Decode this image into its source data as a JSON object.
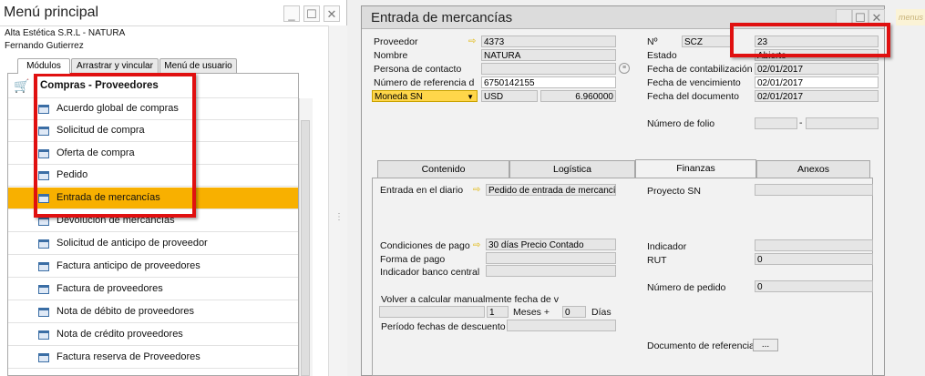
{
  "left_window": {
    "title": "Menú principal",
    "company": "Alta Estética S.R.L - NATURA",
    "user": "Fernando Gutierrez",
    "tabs": [
      "Módulos",
      "Arrastrar y vincular",
      "Menú de usuario"
    ],
    "section": "Compras - Proveedores",
    "items": [
      "Acuerdo global de compras",
      "Solicitud de compra",
      "Oferta de compra",
      "Pedido",
      "Entrada de mercancías",
      "Devolución de mercancías",
      "Solicitud de anticipo de proveedor",
      "Factura anticipo de proveedores",
      "Factura de proveedores",
      "Nota de débito de proveedores",
      "Nota de crédito proveedores",
      "Factura reserva de Proveedores"
    ],
    "selected_index": 4
  },
  "doc_window": {
    "title": "Entrada de mercancías",
    "ghost_text": "menus",
    "header_left": {
      "proveedor_label": "Proveedor",
      "proveedor_value": "4373",
      "nombre_label": "Nombre",
      "nombre_value": "NATURA",
      "contacto_label": "Persona de contacto",
      "contacto_value": "",
      "referencia_label": "Número de referencia d",
      "referencia_value": "6750142155",
      "moneda_select": "Moneda SN",
      "moneda_code": "USD",
      "moneda_rate": "6.960000"
    },
    "header_right": {
      "no_label": "Nº",
      "serie": "SCZ",
      "numero": "23",
      "estado_label": "Estado",
      "estado_value": "Abierto",
      "contab_label": "Fecha de contabilización",
      "contab_value": "02/01/2017",
      "venc_label": "Fecha de vencimiento",
      "venc_value": "02/01/2017",
      "docfecha_label": "Fecha del documento",
      "docfecha_value": "02/01/2017",
      "folio_label": "Número de folio",
      "folio_sep": "-"
    },
    "tabs": [
      "Contenido",
      "Logística",
      "Finanzas",
      "Anexos"
    ],
    "active_tab": "Finanzas",
    "finanzas": {
      "diario_label": "Entrada en el diario",
      "diario_value": "Pedido de entrada de mercancía",
      "condiciones_label": "Condiciones de pago",
      "condiciones_value": "30 días Precio Contado",
      "forma_label": "Forma de pago",
      "banco_label": "Indicador banco central",
      "recalc_label": "Volver a calcular manualmente fecha de v",
      "meses_value": "1",
      "meses_label": "Meses +",
      "dias_value": "0",
      "dias_label": "Días",
      "periodo_label": "Período fechas de descuento p",
      "proyecto_label": "Proyecto SN",
      "indicador_label": "Indicador",
      "rut_label": "RUT",
      "rut_value": "0",
      "pedido_label": "Número de pedido",
      "pedido_value": "0",
      "docref_label": "Documento de referencia",
      "docref_button": "..."
    }
  }
}
